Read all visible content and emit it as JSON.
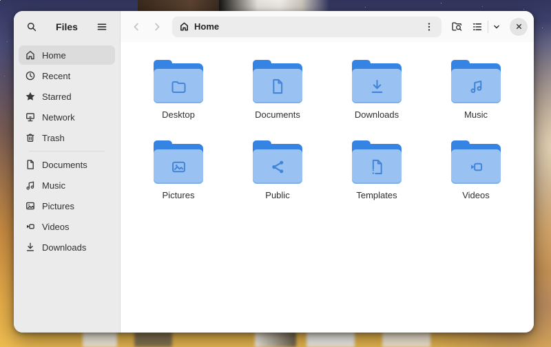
{
  "app": {
    "title": "Files"
  },
  "headerbar": {
    "path": {
      "label": "Home",
      "icon": "home-icon"
    },
    "icons": [
      "back-chevron-icon",
      "forward-chevron-icon",
      "kebab-menu-icon",
      "folder-search-icon",
      "list-view-icon",
      "chevron-down-icon",
      "close-icon"
    ]
  },
  "sidebar": {
    "header_icons": [
      "search-icon",
      "hamburger-menu-icon"
    ],
    "items_top": [
      {
        "label": "Home",
        "icon": "home-icon",
        "selected": true
      },
      {
        "label": "Recent",
        "icon": "clock-icon",
        "selected": false
      },
      {
        "label": "Starred",
        "icon": "star-icon",
        "selected": false
      },
      {
        "label": "Network",
        "icon": "network-icon",
        "selected": false
      },
      {
        "label": "Trash",
        "icon": "trash-icon",
        "selected": false
      }
    ],
    "items_bottom": [
      {
        "label": "Documents",
        "icon": "document-icon"
      },
      {
        "label": "Music",
        "icon": "music-note-icon"
      },
      {
        "label": "Pictures",
        "icon": "image-icon"
      },
      {
        "label": "Videos",
        "icon": "video-camera-icon"
      },
      {
        "label": "Downloads",
        "icon": "download-icon"
      }
    ]
  },
  "files": [
    {
      "name": "Desktop",
      "glyph": "folder-glyph"
    },
    {
      "name": "Documents",
      "glyph": "document-glyph"
    },
    {
      "name": "Downloads",
      "glyph": "download-glyph"
    },
    {
      "name": "Music",
      "glyph": "music-glyph"
    },
    {
      "name": "Pictures",
      "glyph": "image-glyph"
    },
    {
      "name": "Public",
      "glyph": "share-glyph"
    },
    {
      "name": "Templates",
      "glyph": "template-glyph"
    },
    {
      "name": "Videos",
      "glyph": "video-glyph"
    }
  ],
  "colors": {
    "accent_blue": "#3584e4",
    "folder_body_blue": "#99c1f1",
    "folder_glyph_blue": "#4285d8",
    "sidebar_bg": "#ebebeb",
    "sidebar_selected": "#dcdcdc",
    "header_bg": "#fafafa",
    "pathbar_bg": "#ececec",
    "content_bg": "#ffffff"
  }
}
